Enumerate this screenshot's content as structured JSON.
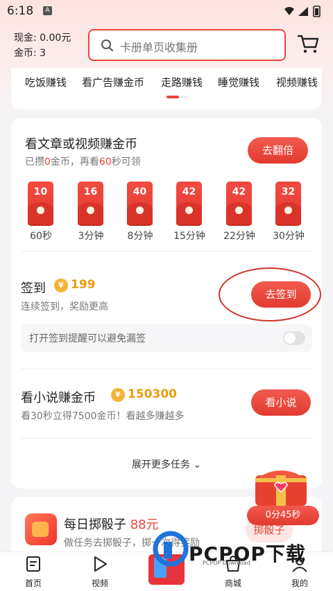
{
  "status_bar": {
    "time": "6:18",
    "notification": "A"
  },
  "wallet": {
    "cash_label": "现金: 0.00元",
    "coin_label": "金币: 3"
  },
  "search": {
    "placeholder": "卡册单页收集册"
  },
  "category_tabs": [
    "吃饭赚钱",
    "看广告赚金币",
    "走路赚钱",
    "睡觉赚钱",
    "视频赚钱"
  ],
  "read_task": {
    "title": "看文章或视频赚金币",
    "sub_prefix": "已攒",
    "sub_coins": "0",
    "sub_mid": "金币，再看",
    "sub_seconds": "60",
    "sub_suffix": "秒可领",
    "button": "去翻倍",
    "rewards": [
      {
        "amount": "10",
        "time": "60秒"
      },
      {
        "amount": "16",
        "time": "3分钟"
      },
      {
        "amount": "40",
        "time": "8分钟"
      },
      {
        "amount": "42",
        "time": "15分钟"
      },
      {
        "amount": "42",
        "time": "22分钟"
      },
      {
        "amount": "32",
        "time": "30分钟"
      }
    ]
  },
  "sign_in": {
    "title": "签到",
    "coins": "199",
    "sub": "连续签到，奖励更高",
    "button": "去签到",
    "reminder": "打开签到提醒可以避免漏签",
    "reminder_on": false
  },
  "novel_task": {
    "title": "看小说赚金币",
    "coins": "150300",
    "sub": "看30秒立得7500金币！看越多赚越多",
    "button": "看小说"
  },
  "expand_more": "展开更多任务",
  "dice": {
    "title": "每日掷骰子",
    "amount": "88元",
    "sub": "做任务去掷骰子，掷一次得奖励",
    "button": "掷骰子"
  },
  "chest": {
    "timer": "0分45秒"
  },
  "bottom_nav": [
    {
      "label": "首页",
      "icon": "home-icon"
    },
    {
      "label": "视频",
      "icon": "play-icon"
    },
    {
      "label": "",
      "icon": "center-promo-icon"
    },
    {
      "label": "商城",
      "icon": "mall-icon"
    },
    {
      "label": "我的",
      "icon": "profile-icon"
    }
  ],
  "watermark": {
    "text": "PCPOP下载",
    "sub": "PCPOP Download"
  },
  "colors": {
    "accent": "#e8453c",
    "coin": "#f5b335",
    "coin_text": "#e89a12"
  }
}
